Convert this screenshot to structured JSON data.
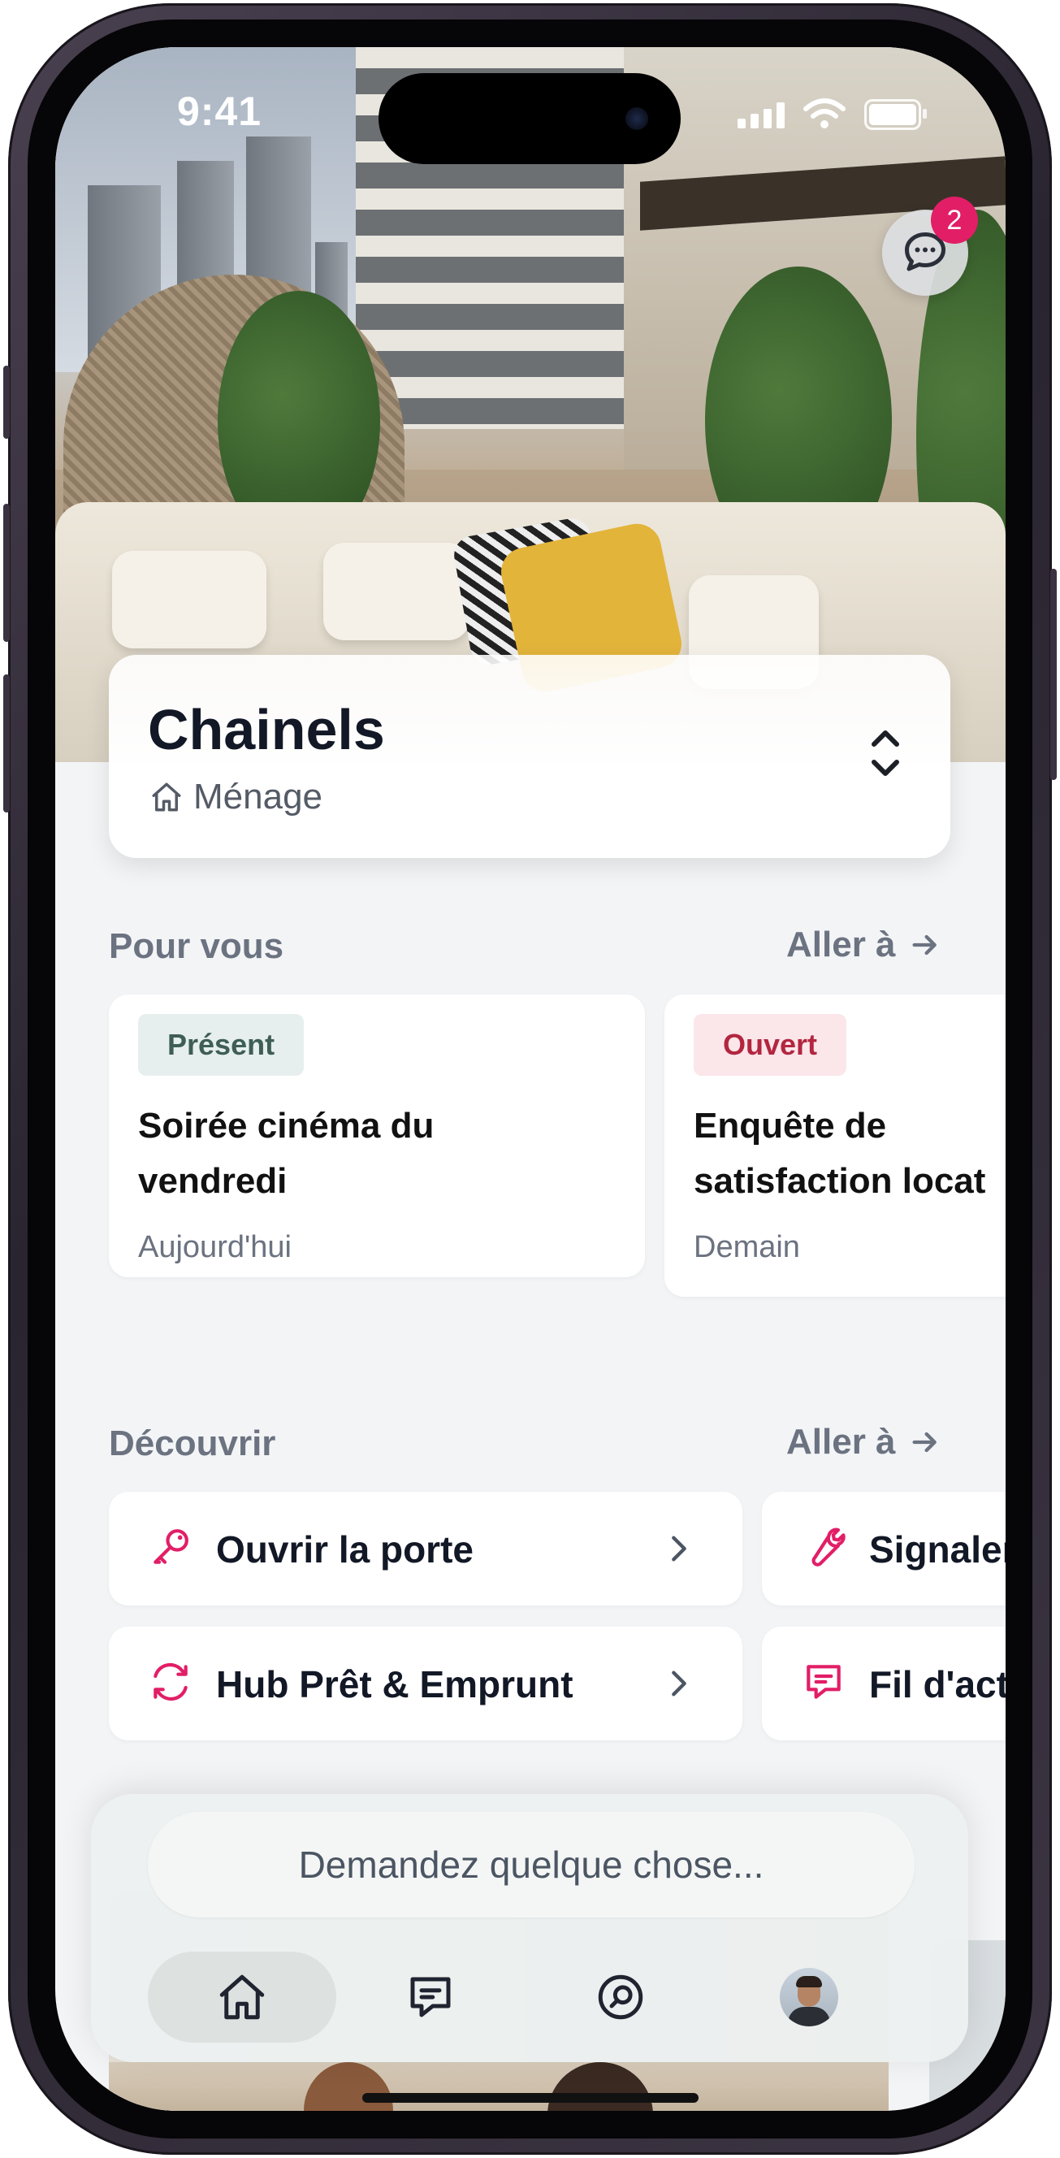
{
  "status_bar": {
    "time": "9:41"
  },
  "header": {
    "chat_badge_count": "2",
    "building_name": "Chainels",
    "building_category": "Ménage"
  },
  "for_you": {
    "title": "Pour vous",
    "goto_label": "Aller à",
    "cards": [
      {
        "status": "Présent",
        "status_bg": "#e6efed",
        "status_fg": "#3f5e55",
        "title_line1": "Soirée cinéma du",
        "title_line2": "vendredi",
        "date": "Aujourd'hui"
      },
      {
        "status": "Ouvert",
        "status_bg": "#fbe6ea",
        "status_fg": "#b3263f",
        "title_line1": "Enquête de",
        "title_line2": "satisfaction locat",
        "date": "Demain"
      }
    ]
  },
  "discover": {
    "title": "Découvrir",
    "goto_label": "Aller à",
    "items": [
      {
        "label": "Ouvrir la porte",
        "icon": "key-icon"
      },
      {
        "label": "Signaler",
        "icon": "wrench-icon"
      },
      {
        "label": "Hub Prêt & Emprunt",
        "icon": "refresh-icon"
      },
      {
        "label": "Fil d'act",
        "icon": "message-square-icon"
      }
    ]
  },
  "bottom": {
    "ask_placeholder": "Demandez quelque chose...",
    "tabs": [
      "home-icon",
      "messages-icon",
      "search-icon",
      "avatar"
    ]
  },
  "colors": {
    "accent": "#e21e67",
    "text_dark": "#121826",
    "muted": "#6b7280",
    "background": "#f3f4f6"
  }
}
